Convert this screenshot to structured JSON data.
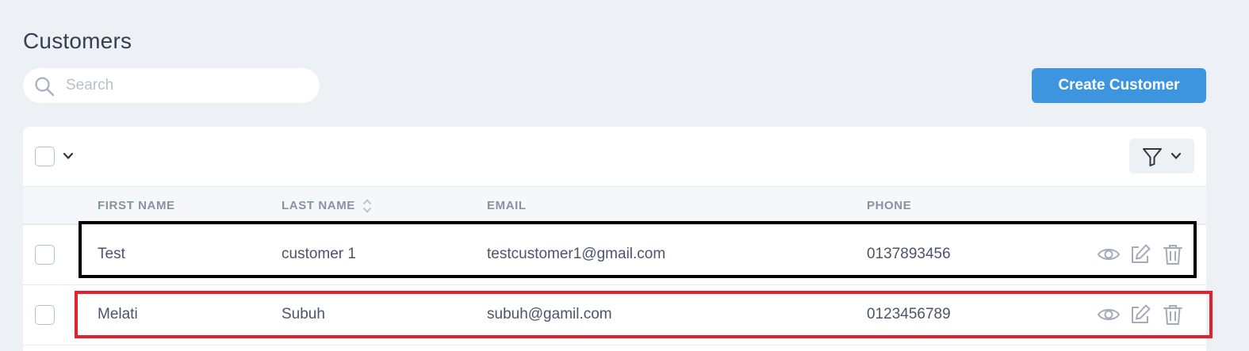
{
  "page": {
    "title": "Customers"
  },
  "search": {
    "placeholder": "Search",
    "value": ""
  },
  "toolbar": {
    "create_label": "Create Customer"
  },
  "table": {
    "columns": [
      "FIRST NAME",
      "LAST NAME",
      "EMAIL",
      "PHONE"
    ],
    "sortable_column": "LAST NAME",
    "rows": [
      {
        "first_name": "Test",
        "last_name": "customer 1",
        "email": "testcustomer1@gmail.com",
        "phone": "0137893456"
      },
      {
        "first_name": "Melati",
        "last_name": "Subuh",
        "email": "subuh@gamil.com",
        "phone": "0123456789"
      }
    ],
    "row_actions": [
      "eye-icon",
      "edit-icon",
      "trash-icon"
    ]
  },
  "highlights": [
    {
      "row": 0,
      "color": "#000000"
    },
    {
      "row": 1,
      "color": "#e5202e"
    }
  ],
  "colors": {
    "accent": "#3d95e0",
    "background": "#edf0f4",
    "text": "#354052",
    "icon": "#a3acb8"
  }
}
